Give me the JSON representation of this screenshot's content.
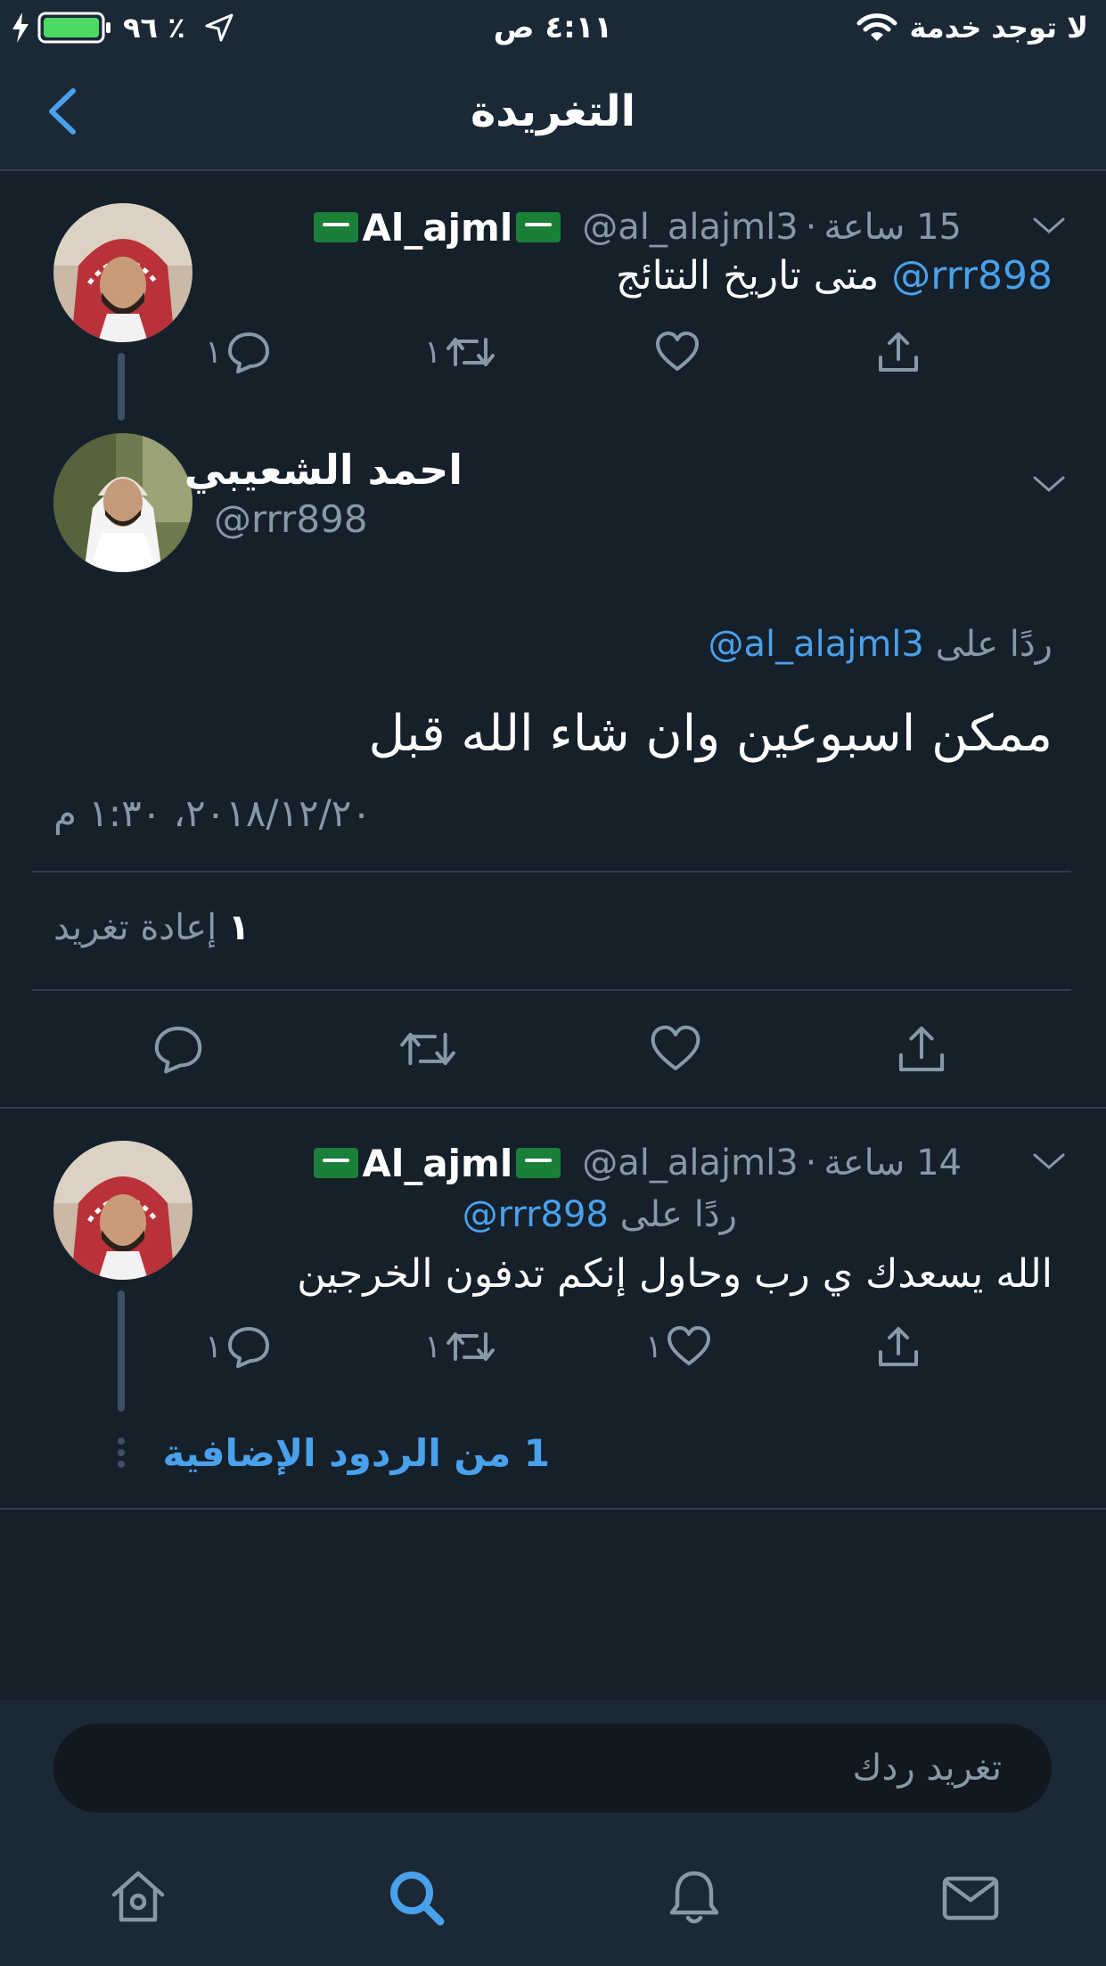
{
  "status_bar": {
    "carrier": "لا توجد خدمة",
    "time": "٤:١١ ص",
    "battery": "٪ ٩٦"
  },
  "header": {
    "title": "التغريدة"
  },
  "tweet1": {
    "name": "Al_ajml",
    "handle": "@al_alajml3",
    "time": "15 ساعة",
    "mention": "@rrr898",
    "text": "متى تاريخ النتائج",
    "reply_count": "١",
    "retweet_count": "١"
  },
  "main_tweet": {
    "name": "احمد الشعيبي",
    "handle": "@rrr898",
    "reply_label": "ردًا على",
    "reply_to": "@al_alajml3",
    "text": "ممكن اسبوعين وان شاء الله قبل",
    "timestamp": "٢٠١٨/١٢/٢٠، ١:٣٠ م",
    "retweets_count": "١",
    "retweets_label": "إعادة تغريد"
  },
  "tweet2": {
    "name": "Al_ajml",
    "handle": "@al_alajml3",
    "time": "14 ساعة",
    "reply_label": "ردًا على",
    "reply_to": "@rrr898",
    "text": "الله يسعدك ي رب  وحاول إنكم تدفون الخرجين",
    "reply_count": "١",
    "retweet_count": "١",
    "like_count": "١",
    "more_replies": "1 من الردود الإضافية"
  },
  "reply_box": {
    "placeholder": "تغريد ردك"
  },
  "colors": {
    "background": "#15202b",
    "bar": "#1b2836",
    "accent": "#4aa1eb",
    "muted": "#8899a6"
  }
}
